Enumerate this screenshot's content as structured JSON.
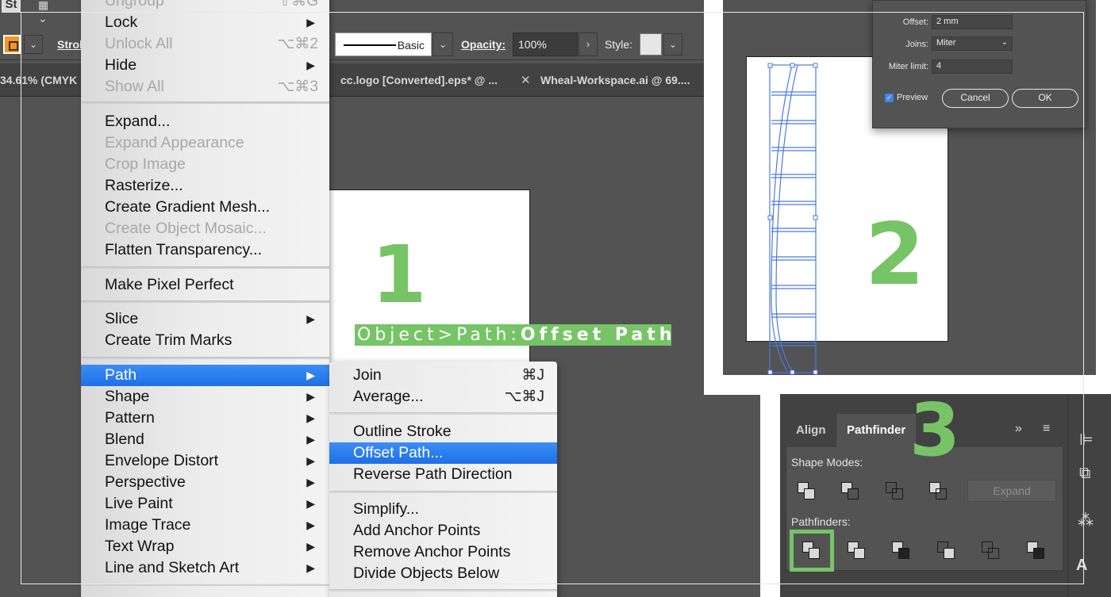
{
  "app": {
    "badge": "St",
    "control_bar": {
      "stroke_label": "Strok",
      "stroke_style": "Basic",
      "opacity_label": "Opacity:",
      "opacity_value": "100%",
      "style_label": "Style:"
    },
    "tabs": [
      {
        "label": "34.61% (CMYK"
      },
      {
        "label": "cc.logo [Converted].eps* @ ..."
      },
      {
        "label": "Wheal-Workspace.ai @ 69...."
      }
    ],
    "accent": "#f7941d"
  },
  "object_menu": {
    "items": [
      {
        "label": "Ungroup",
        "shortcut": "⇧⌘G",
        "disabled": true
      },
      {
        "label": "Lock",
        "arrow": "▶"
      },
      {
        "label": "Unlock All",
        "shortcut": "⌥⌘2",
        "disabled": true
      },
      {
        "label": "Hide",
        "arrow": "▶"
      },
      {
        "label": "Show All",
        "shortcut": "⌥⌘3",
        "disabled": true
      },
      {
        "label": "Expand..."
      },
      {
        "label": "Expand Appearance",
        "disabled": true
      },
      {
        "label": "Crop Image",
        "disabled": true
      },
      {
        "label": "Rasterize..."
      },
      {
        "label": "Create Gradient Mesh..."
      },
      {
        "label": "Create Object Mosaic...",
        "disabled": true
      },
      {
        "label": "Flatten Transparency..."
      },
      {
        "label": "Make Pixel Perfect"
      },
      {
        "label": "Slice",
        "arrow": "▶"
      },
      {
        "label": "Create Trim Marks"
      },
      {
        "label": "Path",
        "arrow": "▶",
        "highlighted": true
      },
      {
        "label": "Shape",
        "arrow": "▶"
      },
      {
        "label": "Pattern",
        "arrow": "▶"
      },
      {
        "label": "Blend",
        "arrow": "▶"
      },
      {
        "label": "Envelope Distort",
        "arrow": "▶"
      },
      {
        "label": "Perspective",
        "arrow": "▶"
      },
      {
        "label": "Live Paint",
        "arrow": "▶"
      },
      {
        "label": "Image Trace",
        "arrow": "▶"
      },
      {
        "label": "Text Wrap",
        "arrow": "▶"
      },
      {
        "label": "Line and Sketch Art",
        "arrow": "▶"
      }
    ]
  },
  "path_submenu": {
    "items": [
      {
        "label": "Join",
        "shortcut": "⌘J"
      },
      {
        "label": "Average...",
        "shortcut": "⌥⌘J"
      },
      {
        "label": "Outline Stroke"
      },
      {
        "label": "Offset Path...",
        "highlighted": true
      },
      {
        "label": "Reverse Path Direction"
      },
      {
        "label": "Simplify..."
      },
      {
        "label": "Add Anchor Points"
      },
      {
        "label": "Remove Anchor Points"
      },
      {
        "label": "Divide Objects Below"
      }
    ]
  },
  "step1": {
    "number": "1",
    "caption_prefix": "Object>Path:",
    "caption_bold": "Offset Path"
  },
  "step2": {
    "number": "2",
    "dialog": {
      "offset_label": "Offset:",
      "offset_value": "2 mm",
      "joins_label": "Joins:",
      "joins_value": "Miter",
      "miter_label": "Miter limit:",
      "miter_value": "4",
      "preview_label": "Preview",
      "preview_checked": true,
      "cancel_label": "Cancel",
      "ok_label": "OK"
    }
  },
  "step3": {
    "number": "3",
    "tabs": {
      "align": "Align",
      "pathfinder": "Pathfinder"
    },
    "more_icon": "»",
    "menu_icon": "≡",
    "shape_modes_label": "Shape Modes:",
    "expand_label": "Expand",
    "pathfinders_label": "Pathfinders:",
    "highlight_color": "#76c466"
  },
  "colors": {
    "annotation_green": "#76c466",
    "menu_highlight": "#2a7bf0"
  }
}
